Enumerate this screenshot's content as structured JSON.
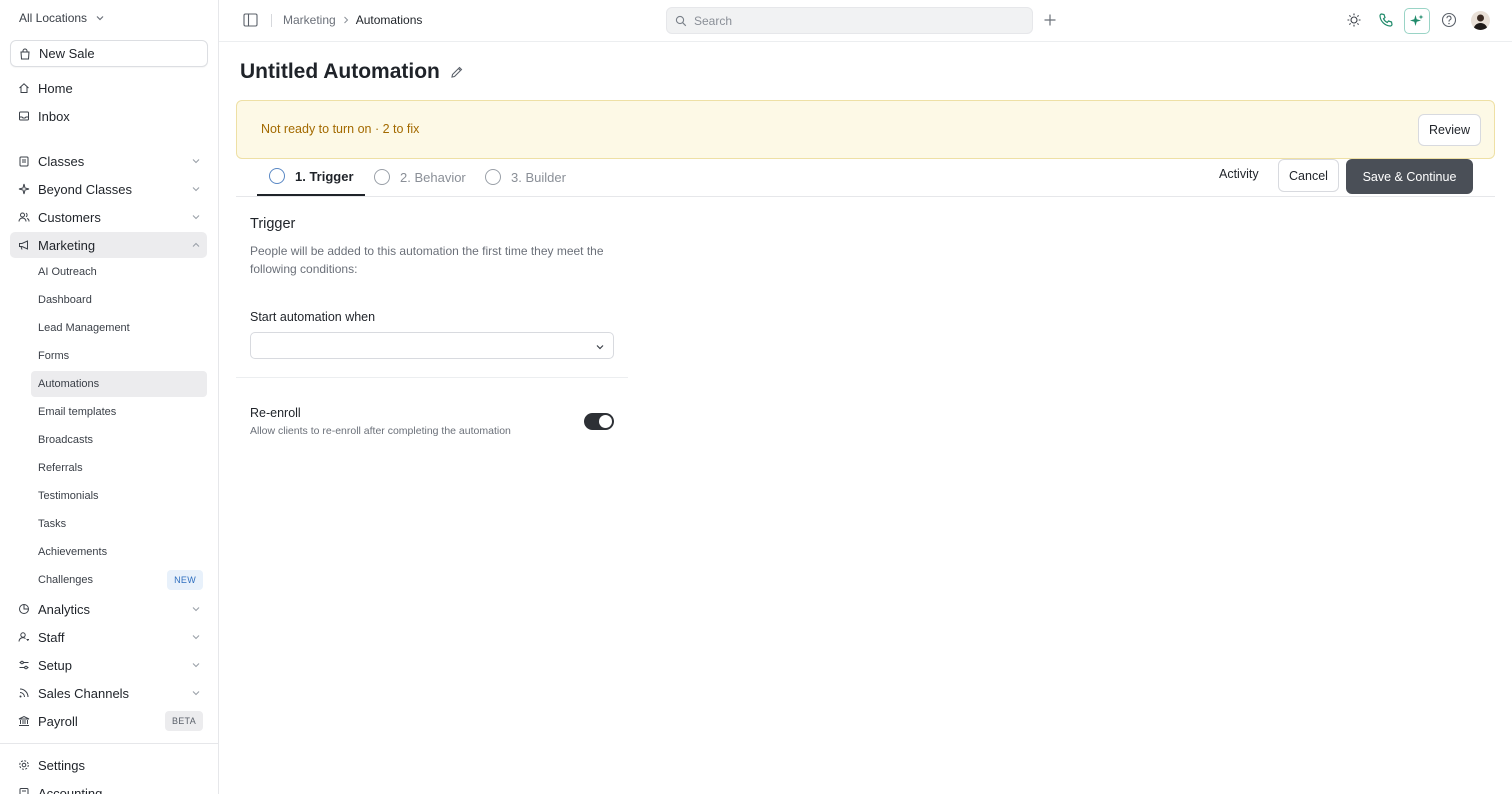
{
  "sidebar": {
    "location": "All Locations",
    "new_sale": "New Sale",
    "items": {
      "home": "Home",
      "inbox": "Inbox",
      "classes": "Classes",
      "beyond_classes": "Beyond Classes",
      "customers": "Customers",
      "marketing": "Marketing",
      "analytics": "Analytics",
      "staff": "Staff",
      "setup": "Setup",
      "sales_channels": "Sales Channels",
      "payroll": "Payroll",
      "settings": "Settings",
      "accounting": "Accounting"
    },
    "marketing_sub": {
      "ai_outreach": "AI Outreach",
      "dashboard": "Dashboard",
      "lead_management": "Lead Management",
      "forms": "Forms",
      "automations": "Automations",
      "email_templates": "Email templates",
      "broadcasts": "Broadcasts",
      "referrals": "Referrals",
      "testimonials": "Testimonials",
      "tasks": "Tasks",
      "achievements": "Achievements",
      "challenges": "Challenges"
    },
    "badges": {
      "challenges": "NEW",
      "payroll": "BETA"
    }
  },
  "topbar": {
    "breadcrumb": {
      "parent": "Marketing",
      "current": "Automations"
    },
    "search_placeholder": "Search"
  },
  "page": {
    "title": "Untitled Automation",
    "alert": {
      "text": "Not ready to turn on · 2 to fix",
      "review": "Review"
    },
    "tabs": {
      "trigger": "1. Trigger",
      "behavior": "2. Behavior",
      "builder": "3. Builder"
    },
    "actions": {
      "activity": "Activity",
      "cancel": "Cancel",
      "save": "Save & Continue"
    },
    "trigger": {
      "title": "Trigger",
      "description": "People will be added to this automation the first time they meet the following conditions:",
      "start_label": "Start automation when",
      "start_value": ""
    },
    "reenroll": {
      "label": "Re-enroll",
      "description": "Allow clients to re-enroll after completing the automation",
      "enabled": true
    }
  },
  "colors": {
    "alert_bg": "#fdf9e6",
    "alert_text": "#a36a00",
    "primary_button": "#4a4f57",
    "phone_icon": "#1f8a6a",
    "active_tab_ring": "#5a88c4"
  }
}
